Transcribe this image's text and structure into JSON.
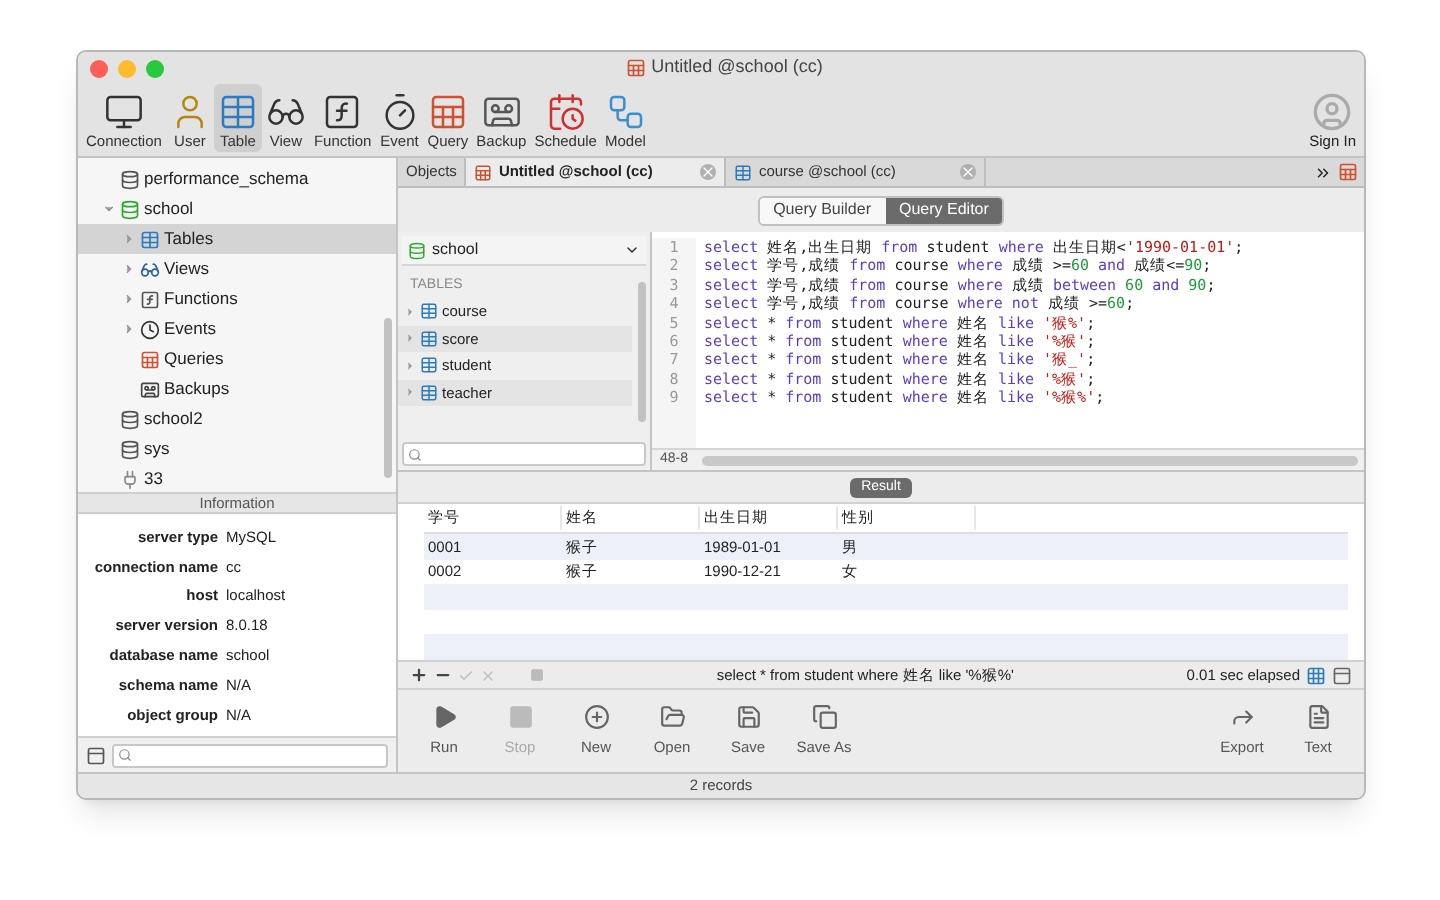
{
  "window": {
    "title": "Untitled @school (cc)"
  },
  "toolbar": [
    {
      "label": "Connection",
      "selected": false
    },
    {
      "label": "User",
      "selected": false
    },
    {
      "label": "Table",
      "selected": true
    },
    {
      "label": "View",
      "selected": false
    },
    {
      "label": "Function",
      "selected": false
    },
    {
      "label": "Event",
      "selected": false
    },
    {
      "label": "Query",
      "selected": false
    },
    {
      "label": "Backup",
      "selected": false
    },
    {
      "label": "Schedule",
      "selected": false
    },
    {
      "label": "Model",
      "selected": false
    }
  ],
  "sign_in": {
    "label": "Sign In"
  },
  "tree": [
    {
      "label": "performance_schema",
      "kind": "database",
      "selected": false
    },
    {
      "label": "school",
      "kind": "database_open",
      "expanded": true,
      "selected": false,
      "children": [
        {
          "label": "Tables",
          "kind": "tables",
          "expanded": false,
          "selected": true
        },
        {
          "label": "Views",
          "kind": "views",
          "expanded": false,
          "selected": false
        },
        {
          "label": "Functions",
          "kind": "functions",
          "expanded": false,
          "selected": false
        },
        {
          "label": "Events",
          "kind": "events",
          "expanded": false,
          "selected": false
        },
        {
          "label": "Queries",
          "kind": "queries",
          "selected": false
        },
        {
          "label": "Backups",
          "kind": "backups",
          "selected": false
        }
      ]
    },
    {
      "label": "school2",
      "kind": "database",
      "selected": false
    },
    {
      "label": "sys",
      "kind": "database",
      "selected": false
    },
    {
      "label": "33",
      "kind": "connection",
      "selected": false
    }
  ],
  "information": {
    "title": "Information",
    "rows": [
      {
        "label": "server type",
        "value": "MySQL"
      },
      {
        "label": "connection name",
        "value": "cc"
      },
      {
        "label": "host",
        "value": "localhost"
      },
      {
        "label": "server version",
        "value": "8.0.18"
      },
      {
        "label": "database name",
        "value": "school"
      },
      {
        "label": "schema name",
        "value": "N/A"
      },
      {
        "label": "object group",
        "value": "N/A"
      }
    ]
  },
  "tabs": [
    {
      "label": "Objects",
      "kind": "objects",
      "selected": false
    },
    {
      "label": "Untitled @school (cc)",
      "kind": "query",
      "selected": true
    },
    {
      "label": "course @school (cc)",
      "kind": "table",
      "selected": false
    }
  ],
  "mode_switch": [
    {
      "label": "Query Builder",
      "selected": false
    },
    {
      "label": "Query Editor",
      "selected": true
    }
  ],
  "database_picker": {
    "value": "school"
  },
  "tables_section": {
    "title": "TABLES",
    "items": [
      "course",
      "score",
      "student",
      "teacher"
    ]
  },
  "editor": {
    "cursor_position": "48-8",
    "lines": [
      {
        "number": "1",
        "tokens": [
          {
            "kind": "kw",
            "text": "select"
          },
          {
            "kind": "plain",
            "text": " 姓名,出生日期 "
          },
          {
            "kind": "kw",
            "text": "from"
          },
          {
            "kind": "plain",
            "text": " student "
          },
          {
            "kind": "kw",
            "text": "where"
          },
          {
            "kind": "plain",
            "text": " 出生日期<"
          },
          {
            "kind": "str",
            "text": "'1990-01-01'"
          },
          {
            "kind": "plain",
            "text": ";"
          }
        ]
      },
      {
        "number": "2",
        "tokens": [
          {
            "kind": "kw",
            "text": "select"
          },
          {
            "kind": "plain",
            "text": " 学号,成绩 "
          },
          {
            "kind": "kw",
            "text": "from"
          },
          {
            "kind": "plain",
            "text": " course "
          },
          {
            "kind": "kw",
            "text": "where"
          },
          {
            "kind": "plain",
            "text": " 成绩 >="
          },
          {
            "kind": "num",
            "text": "60"
          },
          {
            "kind": "kw",
            "text": " and"
          },
          {
            "kind": "plain",
            "text": " 成绩<="
          },
          {
            "kind": "num",
            "text": "90"
          },
          {
            "kind": "plain",
            "text": ";"
          }
        ]
      },
      {
        "number": "3",
        "tokens": [
          {
            "kind": "kw",
            "text": "select"
          },
          {
            "kind": "plain",
            "text": " 学号,成绩 "
          },
          {
            "kind": "kw",
            "text": "from"
          },
          {
            "kind": "plain",
            "text": " course "
          },
          {
            "kind": "kw",
            "text": "where"
          },
          {
            "kind": "plain",
            "text": " 成绩 "
          },
          {
            "kind": "kw",
            "text": "between"
          },
          {
            "kind": "num",
            "text": " 60"
          },
          {
            "kind": "kw",
            "text": " and"
          },
          {
            "kind": "num",
            "text": " 90"
          },
          {
            "kind": "plain",
            "text": ";"
          }
        ]
      },
      {
        "number": "4",
        "tokens": [
          {
            "kind": "kw",
            "text": "select"
          },
          {
            "kind": "plain",
            "text": " 学号,成绩 "
          },
          {
            "kind": "kw",
            "text": "from"
          },
          {
            "kind": "plain",
            "text": " course "
          },
          {
            "kind": "kw",
            "text": "where"
          },
          {
            "kind": "kw",
            "text": " not"
          },
          {
            "kind": "plain",
            "text": " 成绩 >="
          },
          {
            "kind": "num",
            "text": "60"
          },
          {
            "kind": "plain",
            "text": ";"
          }
        ]
      },
      {
        "number": "5",
        "tokens": [
          {
            "kind": "kw",
            "text": "select"
          },
          {
            "kind": "plain",
            "text": " * "
          },
          {
            "kind": "kw",
            "text": "from"
          },
          {
            "kind": "plain",
            "text": " student "
          },
          {
            "kind": "kw",
            "text": "where"
          },
          {
            "kind": "plain",
            "text": " 姓名 "
          },
          {
            "kind": "kw",
            "text": "like"
          },
          {
            "kind": "str",
            "text": " '猴%'"
          },
          {
            "kind": "plain",
            "text": ";"
          }
        ]
      },
      {
        "number": "6",
        "tokens": [
          {
            "kind": "kw",
            "text": "select"
          },
          {
            "kind": "plain",
            "text": " * "
          },
          {
            "kind": "kw",
            "text": "from"
          },
          {
            "kind": "plain",
            "text": " student "
          },
          {
            "kind": "kw",
            "text": "where"
          },
          {
            "kind": "plain",
            "text": " 姓名 "
          },
          {
            "kind": "kw",
            "text": "like"
          },
          {
            "kind": "str",
            "text": " '%猴'"
          },
          {
            "kind": "plain",
            "text": ";"
          }
        ]
      },
      {
        "number": "7",
        "tokens": [
          {
            "kind": "kw",
            "text": "select"
          },
          {
            "kind": "plain",
            "text": " * "
          },
          {
            "kind": "kw",
            "text": "from"
          },
          {
            "kind": "plain",
            "text": " student "
          },
          {
            "kind": "kw",
            "text": "where"
          },
          {
            "kind": "plain",
            "text": " 姓名 "
          },
          {
            "kind": "kw",
            "text": "like"
          },
          {
            "kind": "str",
            "text": " '猴_'"
          },
          {
            "kind": "plain",
            "text": ";"
          }
        ]
      },
      {
        "number": "8",
        "tokens": [
          {
            "kind": "kw",
            "text": "select"
          },
          {
            "kind": "plain",
            "text": " * "
          },
          {
            "kind": "kw",
            "text": "from"
          },
          {
            "kind": "plain",
            "text": " student "
          },
          {
            "kind": "kw",
            "text": "where"
          },
          {
            "kind": "plain",
            "text": " 姓名 "
          },
          {
            "kind": "kw",
            "text": "like"
          },
          {
            "kind": "str",
            "text": " '%猴'"
          },
          {
            "kind": "plain",
            "text": ";"
          }
        ]
      },
      {
        "number": "9",
        "tokens": [
          {
            "kind": "kw",
            "text": "select"
          },
          {
            "kind": "plain",
            "text": " * "
          },
          {
            "kind": "kw",
            "text": "from"
          },
          {
            "kind": "plain",
            "text": " student "
          },
          {
            "kind": "kw",
            "text": "where"
          },
          {
            "kind": "plain",
            "text": " 姓名 "
          },
          {
            "kind": "kw",
            "text": "like"
          },
          {
            "kind": "str",
            "text": " '%猴%'"
          },
          {
            "kind": "plain",
            "text": ";"
          }
        ]
      }
    ]
  },
  "result": {
    "title": "Result",
    "columns": [
      "学号",
      "姓名",
      "出生日期",
      "性别"
    ],
    "rows": [
      [
        "0001",
        "猴子",
        "1989-01-01",
        "男"
      ],
      [
        "0002",
        "猴子",
        "1990-12-21",
        "女"
      ]
    ]
  },
  "result_bar": {
    "query": "select * from student where 姓名 like '%猴%'",
    "elapsed": "0.01 sec elapsed"
  },
  "actions": [
    {
      "label": "Run",
      "disabled": false
    },
    {
      "label": "Stop",
      "disabled": true
    },
    {
      "label": "New",
      "disabled": false
    },
    {
      "label": "Open",
      "disabled": false
    },
    {
      "label": "Save",
      "disabled": false
    },
    {
      "label": "Save As",
      "disabled": false
    },
    {
      "label": "Export",
      "disabled": false
    },
    {
      "label": "Text",
      "disabled": false
    }
  ],
  "status_bar": {
    "text": "2 records"
  }
}
